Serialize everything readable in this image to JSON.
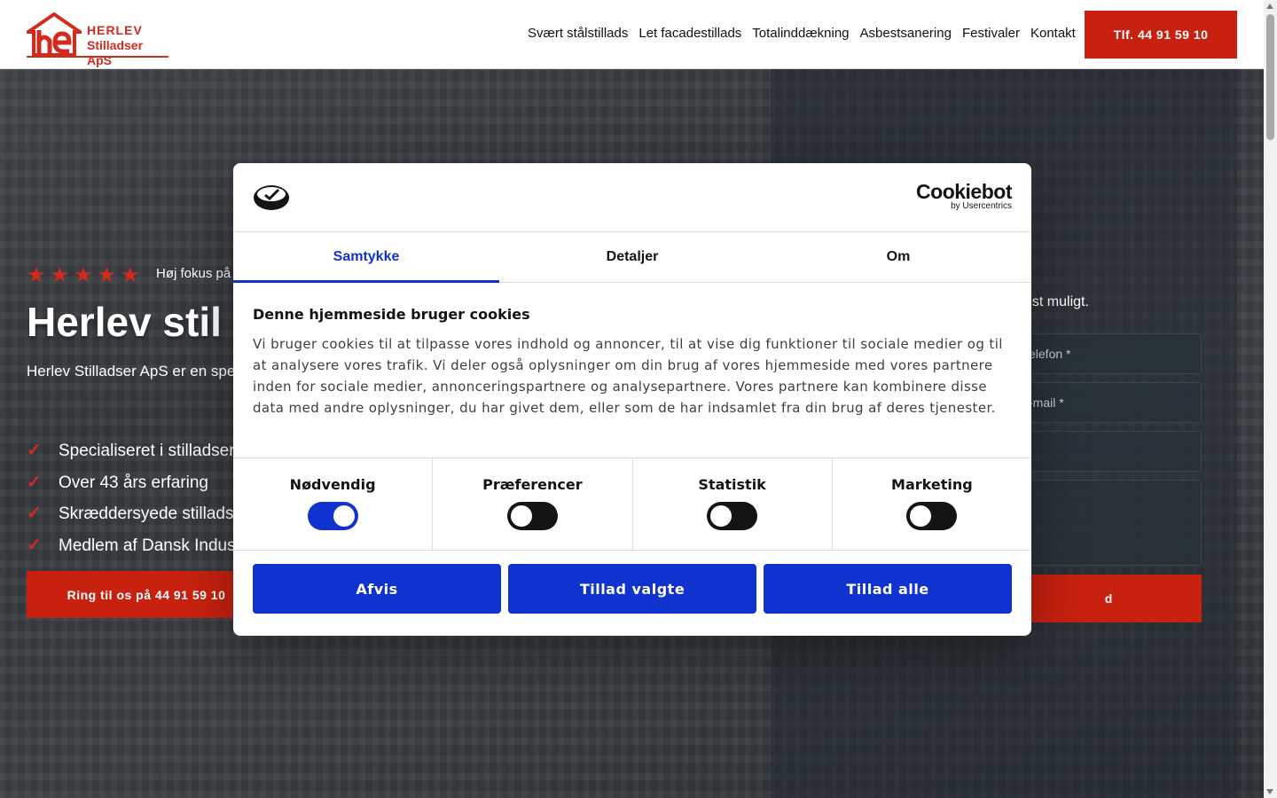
{
  "header": {
    "logo_line1": "HERLEV",
    "logo_line2": "Stilladser ApS",
    "nav": [
      "Svært stålstillads",
      "Let facadestillads",
      "Totalinddækning",
      "Asbestsanering",
      "Festivaler",
      "Kontakt"
    ],
    "phone_label": "Tlf. 44 91 59 10"
  },
  "hero": {
    "rating_stars": 5,
    "rating_text": "Høj fokus på",
    "title": "Herlev stil",
    "description": "Herlev Stilladser ApS er en spe stilladsløsninger til erhvervsku",
    "checks": [
      "Specialiseret i stilladser",
      "Over 43 års erfaring",
      "Skræddersyede stilladsl",
      "Medlem af Dansk Indus"
    ],
    "call_button": "Ring til os på 44 91 59 10"
  },
  "form": {
    "lead": "gst muligt.",
    "fields": [
      "elefon *",
      "-mail *",
      "",
      ""
    ],
    "submit_label": "d"
  },
  "cookie_modal": {
    "brand": "Cookiebot",
    "brand_sub": "by Usercentrics",
    "tabs": [
      "Samtykke",
      "Detaljer",
      "Om"
    ],
    "active_tab": "Samtykke",
    "heading": "Denne hjemmeside bruger cookies",
    "body": "Vi bruger cookies til at tilpasse vores indhold og annoncer, til at vise dig funktioner til sociale medier og til at analysere vores trafik. Vi deler også oplysninger om din brug af vores hjemmeside med vores partnere inden for sociale medier, annonceringspartnere og analysepartnere. Vores partnere kan kombinere disse data med andre oplysninger, du har givet dem, eller som de har indsamlet fra din brug af deres tjenester.",
    "toggles": [
      {
        "label": "Nødvendig",
        "on": true
      },
      {
        "label": "Præferencer",
        "on": false
      },
      {
        "label": "Statistik",
        "on": false
      },
      {
        "label": "Marketing",
        "on": false
      }
    ],
    "buttons": [
      "Afvis",
      "Tillad valgte",
      "Tillad alle"
    ]
  },
  "colors": {
    "brand_red": "#c8210f",
    "cookiebot_blue": "#1032cf"
  }
}
